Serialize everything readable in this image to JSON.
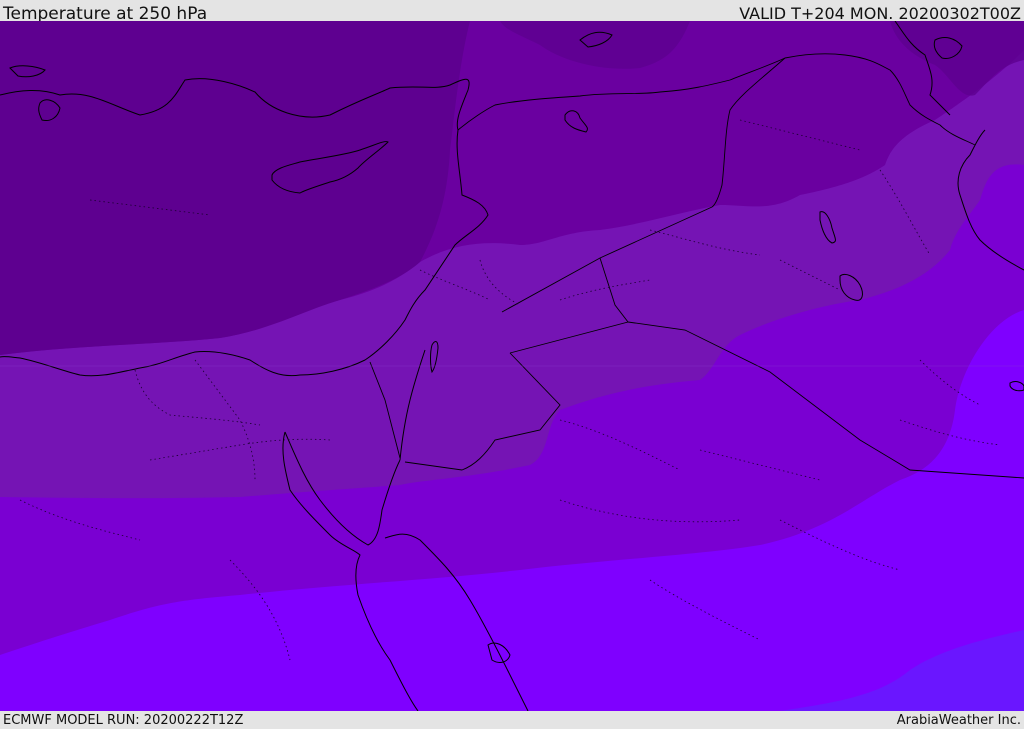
{
  "header": {
    "title": "Temperature at 250 hPa",
    "valid_time": "VALID T+204 MON. 20200302T00Z"
  },
  "footer": {
    "model_run": "ECMWF MODEL RUN: 20200222T12Z",
    "credit": "ArabiaWeather Inc."
  },
  "map": {
    "variable": "temperature",
    "level": "250 hPa",
    "colors": {
      "darkest": "#5e0090",
      "dark": "#6a00a0",
      "mid_dark": "#7514b4",
      "mid": "#7a00d2",
      "bright": "#7f00ff",
      "blue_violet": "#6a16ff",
      "coastline": "#000000",
      "border": "#000000"
    },
    "features": [
      "contour-fill-bands",
      "coastlines",
      "country-borders",
      "admin-boundaries-dotted"
    ]
  }
}
